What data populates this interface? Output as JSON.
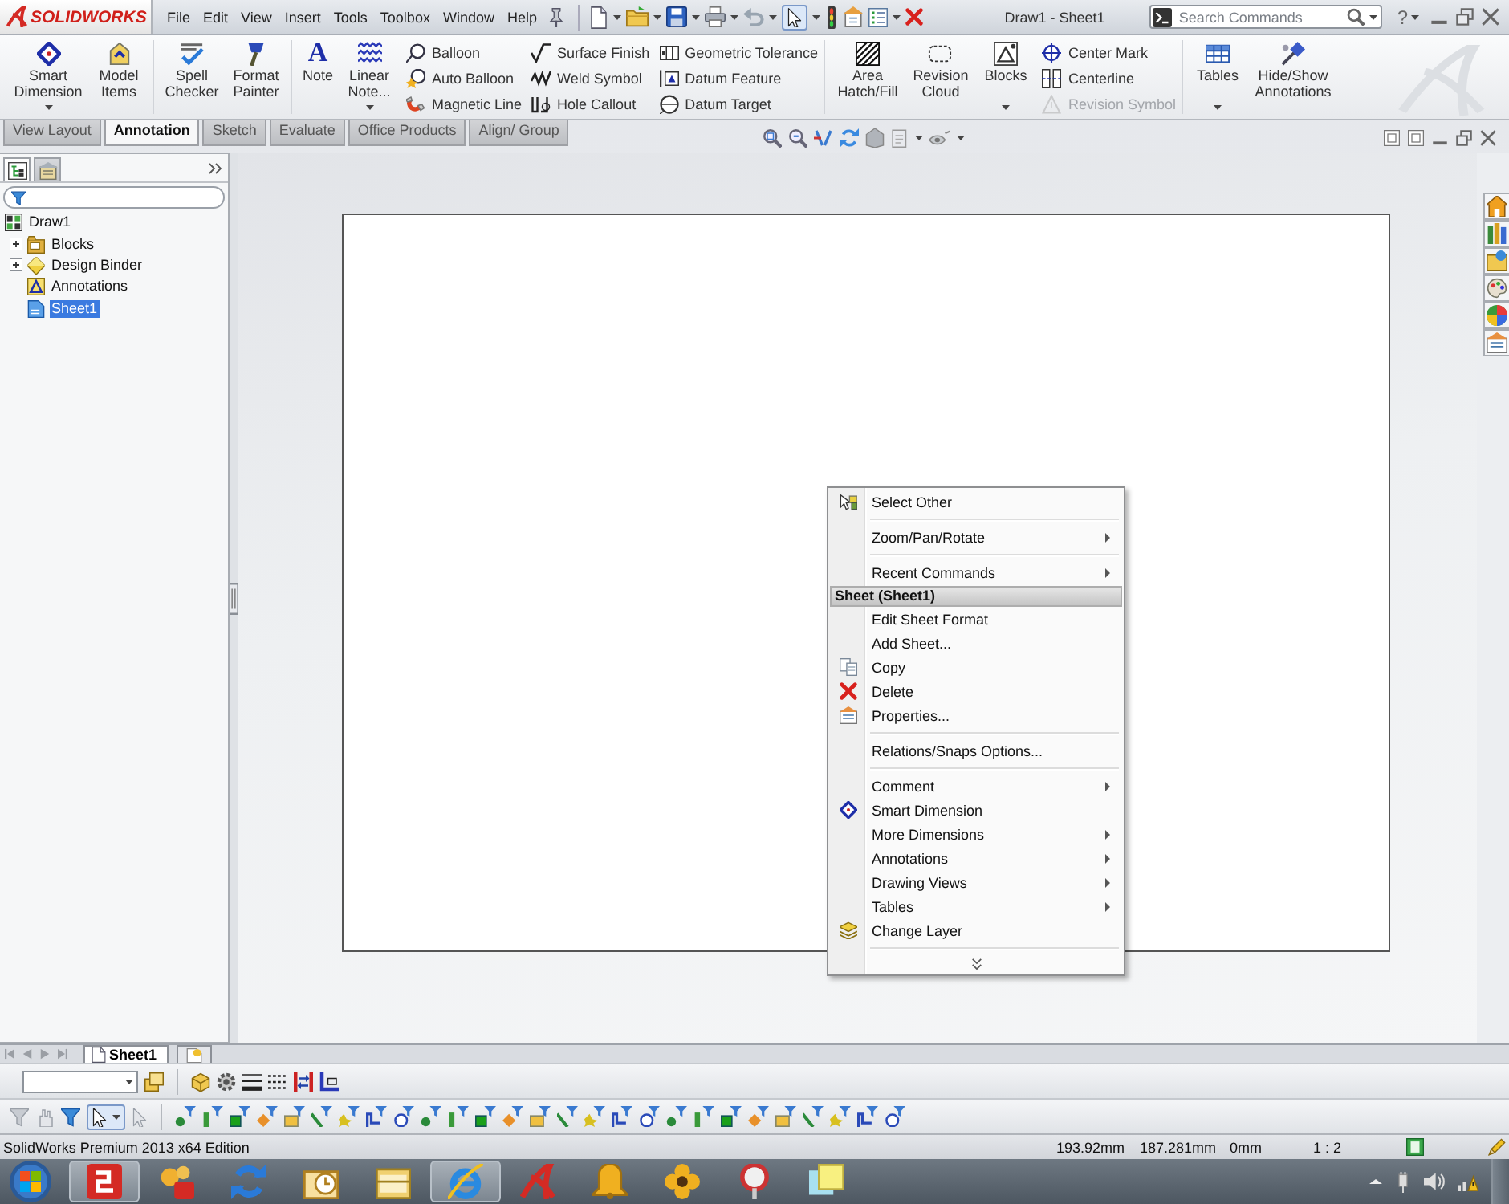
{
  "title_bar": {
    "logo": "SOLIDWORKS",
    "menu": [
      "File",
      "Edit",
      "View",
      "Insert",
      "Tools",
      "Toolbox",
      "Window",
      "Help"
    ],
    "select_tool_active": true,
    "document_title": "Draw1 - Sheet1",
    "search": {
      "placeholder": "Search Commands"
    },
    "help": "?"
  },
  "ribbon": {
    "groups": [
      {
        "items": [
          {
            "kind": "large",
            "label": "Smart Dimension",
            "dropdown": true
          },
          {
            "kind": "large",
            "label": "Model Items",
            "dropdown": false
          }
        ]
      },
      {
        "items": [
          {
            "kind": "large",
            "label": "Spell Checker",
            "dropdown": false
          },
          {
            "kind": "large",
            "label": "Format Painter",
            "dropdown": false
          }
        ]
      },
      {
        "items": [
          {
            "kind": "large",
            "label": "Note",
            "glyph": "A",
            "dropdown": false
          },
          {
            "kind": "large",
            "label": "Linear Note...",
            "dropdown": true
          },
          {
            "kind": "stack",
            "items": [
              {
                "label": "Balloon",
                "disabled": false
              },
              {
                "label": "Auto Balloon",
                "disabled": false
              },
              {
                "label": "Magnetic Line",
                "disabled": false
              }
            ]
          },
          {
            "kind": "stack",
            "items": [
              {
                "label": "Surface Finish",
                "disabled": false
              },
              {
                "label": "Weld Symbol",
                "disabled": false
              },
              {
                "label": "Hole Callout",
                "disabled": false
              }
            ]
          },
          {
            "kind": "stack",
            "items": [
              {
                "label": "Geometric Tolerance",
                "disabled": false
              },
              {
                "label": "Datum Feature",
                "disabled": false
              },
              {
                "label": "Datum Target",
                "disabled": false
              }
            ]
          }
        ]
      },
      {
        "items": [
          {
            "kind": "large",
            "label": "Area Hatch/Fill",
            "dropdown": false
          },
          {
            "kind": "large",
            "label": "Revision Cloud",
            "dropdown": false
          },
          {
            "kind": "large",
            "label": "Blocks",
            "dropdown": true
          },
          {
            "kind": "stack",
            "items": [
              {
                "label": "Center Mark",
                "disabled": false
              },
              {
                "label": "Centerline",
                "disabled": false
              },
              {
                "label": "Revision Symbol",
                "disabled": true
              }
            ]
          }
        ]
      },
      {
        "items": [
          {
            "kind": "large",
            "label": "Tables",
            "dropdown": true
          },
          {
            "kind": "large",
            "label": "Hide/Show Annotations",
            "dropdown": false
          }
        ]
      }
    ],
    "tabs": [
      {
        "label": "View Layout",
        "selected": false
      },
      {
        "label": "Annotation",
        "selected": true
      },
      {
        "label": "Sketch",
        "selected": false
      },
      {
        "label": "Evaluate",
        "selected": false
      },
      {
        "label": "Office Products",
        "selected": false
      },
      {
        "label": "Align/ Group",
        "selected": false
      }
    ]
  },
  "feature_manager": {
    "panel_tabs": [
      {
        "selected": true
      },
      {
        "selected": false
      }
    ],
    "tree": {
      "label": "Draw1",
      "selected": false,
      "children": [
        {
          "label": "Blocks",
          "expandable": true,
          "selected": false
        },
        {
          "label": "Design Binder",
          "expandable": true,
          "selected": false
        },
        {
          "label": "Annotations",
          "expandable": false,
          "selected": false
        },
        {
          "label": "Sheet1",
          "expandable": false,
          "selected": true
        }
      ]
    }
  },
  "context_menu": {
    "groups": [
      {
        "items": [
          {
            "label": "Select Other",
            "submenu": false
          }
        ]
      },
      {
        "items": [
          {
            "label": "Zoom/Pan/Rotate",
            "submenu": true
          }
        ]
      },
      {
        "items": [
          {
            "label": "Recent Commands",
            "submenu": true
          }
        ]
      },
      {
        "heading": "Sheet (Sheet1)",
        "items": [
          {
            "label": "Edit Sheet Format",
            "submenu": false
          },
          {
            "label": "Add Sheet...",
            "submenu": false
          },
          {
            "label": "Copy",
            "submenu": false
          },
          {
            "label": "Delete",
            "submenu": false
          },
          {
            "label": "Properties...",
            "submenu": false
          }
        ]
      },
      {
        "items": [
          {
            "label": "Relations/Snaps Options...",
            "submenu": false
          }
        ]
      },
      {
        "items": [
          {
            "label": "Comment",
            "submenu": true
          },
          {
            "label": "Smart Dimension",
            "submenu": false
          },
          {
            "label": "More Dimensions",
            "submenu": true
          },
          {
            "label": "Annotations",
            "submenu": true
          },
          {
            "label": "Drawing Views",
            "submenu": true
          },
          {
            "label": "Tables",
            "submenu": true
          },
          {
            "label": "Change Layer",
            "submenu": false
          }
        ]
      }
    ]
  },
  "sheet_tabs": [
    {
      "label": "Sheet1",
      "selected": true
    }
  ],
  "selection_filter": {
    "select_active": true
  },
  "status_bar": {
    "edition": "SolidWorks Premium 2013 x64 Edition",
    "fields": [
      "193.92mm",
      "187.281mm",
      "0mm",
      "1 : 2"
    ]
  },
  "taskbar": {
    "apps": [
      {
        "running": true
      },
      {
        "running": false
      },
      {
        "running": false
      },
      {
        "running": false
      },
      {
        "running": false
      },
      {
        "running": true
      },
      {
        "running": false
      },
      {
        "running": false
      },
      {
        "running": false
      },
      {
        "running": false
      },
      {
        "running": false
      }
    ]
  }
}
